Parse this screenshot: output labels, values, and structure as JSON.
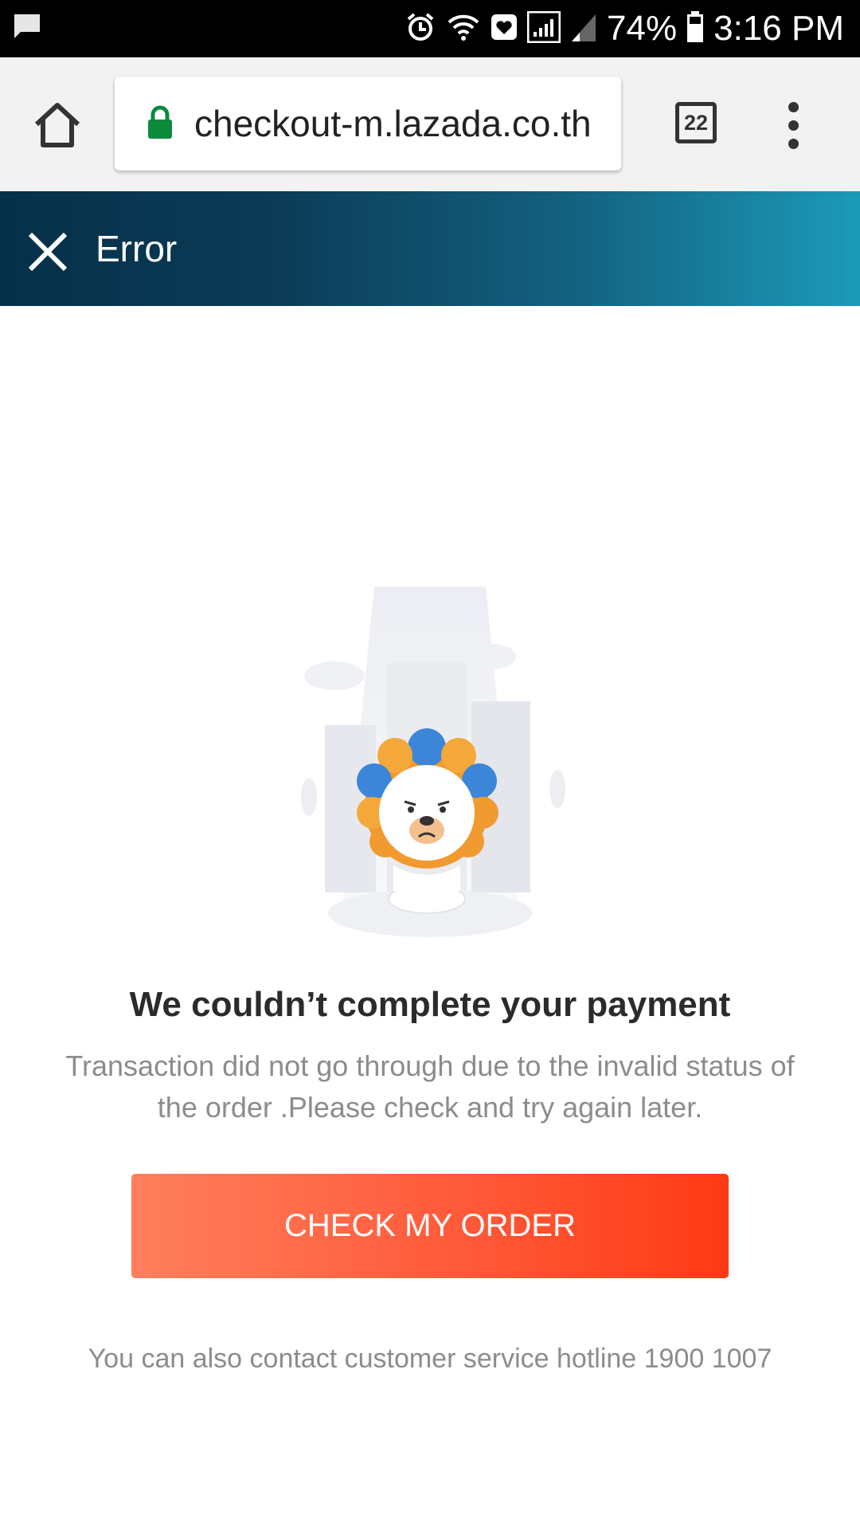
{
  "status_bar": {
    "battery_percent": "74%",
    "time": "3:16 PM",
    "icons": [
      "message-icon",
      "alarm-icon",
      "wifi-icon",
      "health-icon",
      "signal-icon",
      "signal-weak-icon",
      "battery-icon"
    ]
  },
  "browser": {
    "url": "checkout-m.lazada.co.th",
    "tab_count": "22",
    "colors": {
      "lock": "#0b8a3c"
    }
  },
  "header": {
    "title": "Error",
    "colors": {
      "gradient_start": "#06304a",
      "gradient_end": "#1b9ab8"
    }
  },
  "error": {
    "title": "We couldn’t complete your payment",
    "description": "Transaction did not go through due to the invalid status of the order .Please check and try again later.",
    "button_label": "CHECK MY ORDER",
    "hotline_text": "You can also contact customer service hotline 1900 1007",
    "colors": {
      "button_start": "#ff7f5c",
      "button_end": "#ff3a14"
    }
  }
}
